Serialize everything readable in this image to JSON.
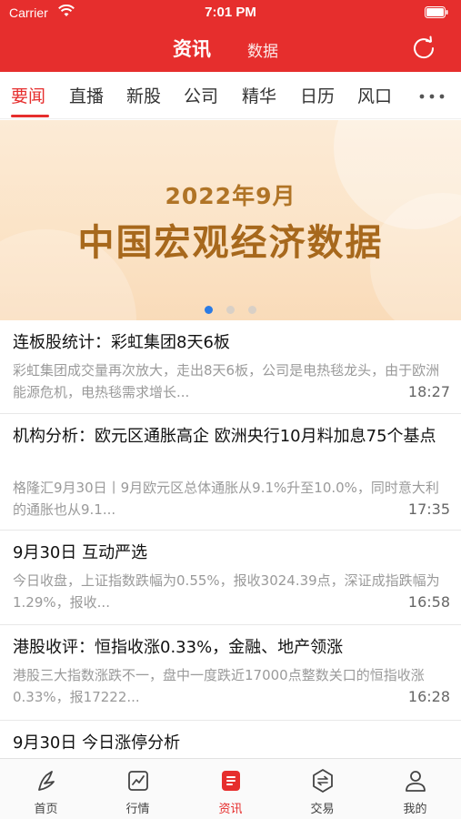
{
  "status_bar": {
    "carrier": "Carrier",
    "time": "7:01 PM"
  },
  "header": {
    "title": "资讯",
    "alt_title": "数据"
  },
  "tabs": [
    "要闻",
    "直播",
    "新股",
    "公司",
    "精华",
    "日历",
    "风口"
  ],
  "active_tab": "要闻",
  "banner": {
    "subtitle": "2022年9月",
    "title": "中国宏观经济数据",
    "page_count": 3,
    "active_page": 1
  },
  "news": [
    {
      "title": "连板股统计：彩虹集团8天6板",
      "summary": "彩虹集团成交量再次放大，走出8天6板，公司是电热毯龙头，由于欧洲能源危机，电热毯需求增长...",
      "time": "18:27"
    },
    {
      "title": "机构分析：欧元区通胀高企 欧洲央行10月料加息75个基点",
      "summary": "格隆汇9月30日丨9月欧元区总体通胀从9.1%升至10.0%，同时意大利的通胀也从9.1...",
      "time": "17:35"
    },
    {
      "title": "9月30日 互动严选",
      "summary": "今日收盘，上证指数跌幅为0.55%，报收3024.39点，深证成指跌幅为1.29%，报收...",
      "time": "16:58"
    },
    {
      "title": "港股收评：恒指收涨0.33%，金融、地产领涨",
      "summary": "港股三大指数涨跌不一，盘中一度跌近17000点整数关口的恒指收涨0.33%，报17222...",
      "time": "16:28"
    },
    {
      "title": "9月30日 今日涨停分析",
      "summary": "",
      "time": ""
    }
  ],
  "tabbar": [
    {
      "label": "首页",
      "icon": "home-icon"
    },
    {
      "label": "行情",
      "icon": "chart-icon"
    },
    {
      "label": "资讯",
      "icon": "news-icon"
    },
    {
      "label": "交易",
      "icon": "trade-icon"
    },
    {
      "label": "我的",
      "icon": "profile-icon"
    }
  ],
  "active_tabbar": "资讯",
  "colors": {
    "brand": "#e62e2d",
    "banner_text": "#a7681c",
    "dot_active": "#2b7be4"
  }
}
